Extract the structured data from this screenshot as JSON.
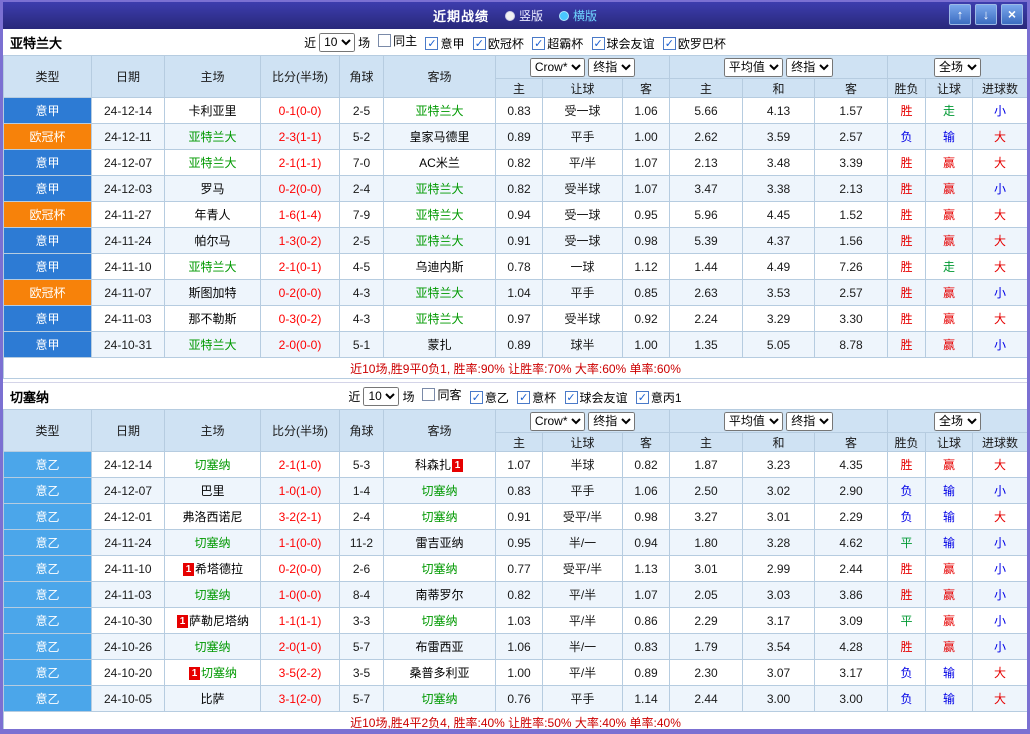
{
  "titlebar": {
    "title": "近期战绩",
    "vertical_label": "竖版",
    "horizontal_label": "横版",
    "up_icon": "↑",
    "down_icon": "↓",
    "close_icon": "×"
  },
  "filter_labels": {
    "near": "近",
    "count": "10",
    "games": "场"
  },
  "table_head": {
    "type": "类型",
    "date": "日期",
    "home": "主场",
    "score": "比分(半场)",
    "corner": "角球",
    "away": "客场",
    "odds_home": "主",
    "odds_handicap": "让球",
    "odds_away": "客",
    "avg_home": "主",
    "avg_draw": "和",
    "avg_away": "客",
    "result": "胜负",
    "handicap_result": "让球",
    "goals": "进球数",
    "odds_select": "Crow*",
    "final_select": "终指",
    "avg_select": "平均值",
    "avg_final_select": "终指",
    "scope_select": "全场"
  },
  "colors": {
    "accent_purple": "#7b70d2",
    "titlebar_blue": "#32329b",
    "league_seriea_blue": "#2d7bd4",
    "league_ucl_orange": "#f7820a",
    "league_serieb_blue": "#4ba6ea",
    "win_red": "#e60000",
    "lose_blue": "#0000e6",
    "draw_green": "#009933",
    "team_green": "#009900",
    "score_red": "#ff0000",
    "header_bg": "#cfe2f3"
  },
  "sections": [
    {
      "team": "亚特兰大",
      "checkboxes": [
        {
          "label": "同主",
          "checked": false
        },
        {
          "label": "意甲",
          "checked": true
        },
        {
          "label": "欧冠杯",
          "checked": true
        },
        {
          "label": "超霸杯",
          "checked": true
        },
        {
          "label": "球会友谊",
          "checked": true
        },
        {
          "label": "欧罗巴杯",
          "checked": true
        }
      ],
      "rows": [
        {
          "league": "意甲",
          "date": "24-12-14",
          "home": "卡利亚里",
          "score": "0-1(0-0)",
          "corner": "2-5",
          "away": "亚特兰大",
          "o1": "0.83",
          "o2": "受一球",
          "o3": "1.06",
          "a1": "5.66",
          "a2": "4.13",
          "a3": "1.57",
          "r1": "胜",
          "r2": "走",
          "r3": "小"
        },
        {
          "league": "欧冠杯",
          "date": "24-12-11",
          "home": "亚特兰大",
          "score": "2-3(1-1)",
          "corner": "5-2",
          "away": "皇家马德里",
          "o1": "0.89",
          "o2": "平手",
          "o3": "1.00",
          "a1": "2.62",
          "a2": "3.59",
          "a3": "2.57",
          "r1": "负",
          "r2": "输",
          "r3": "大"
        },
        {
          "league": "意甲",
          "date": "24-12-07",
          "home": "亚特兰大",
          "score": "2-1(1-1)",
          "corner": "7-0",
          "away": "AC米兰",
          "o1": "0.82",
          "o2": "平/半",
          "o3": "1.07",
          "a1": "2.13",
          "a2": "3.48",
          "a3": "3.39",
          "r1": "胜",
          "r2": "赢",
          "r3": "大"
        },
        {
          "league": "意甲",
          "date": "24-12-03",
          "home": "罗马",
          "score": "0-2(0-0)",
          "corner": "2-4",
          "away": "亚特兰大",
          "o1": "0.82",
          "o2": "受半球",
          "o3": "1.07",
          "a1": "3.47",
          "a2": "3.38",
          "a3": "2.13",
          "r1": "胜",
          "r2": "赢",
          "r3": "小"
        },
        {
          "league": "欧冠杯",
          "date": "24-11-27",
          "home": "年青人",
          "score": "1-6(1-4)",
          "corner": "7-9",
          "away": "亚特兰大",
          "o1": "0.94",
          "o2": "受一球",
          "o3": "0.95",
          "a1": "5.96",
          "a2": "4.45",
          "a3": "1.52",
          "r1": "胜",
          "r2": "赢",
          "r3": "大"
        },
        {
          "league": "意甲",
          "date": "24-11-24",
          "home": "帕尔马",
          "score": "1-3(0-2)",
          "corner": "2-5",
          "away": "亚特兰大",
          "o1": "0.91",
          "o2": "受一球",
          "o3": "0.98",
          "a1": "5.39",
          "a2": "4.37",
          "a3": "1.56",
          "r1": "胜",
          "r2": "赢",
          "r3": "大"
        },
        {
          "league": "意甲",
          "date": "24-11-10",
          "home": "亚特兰大",
          "score": "2-1(0-1)",
          "corner": "4-5",
          "away": "乌迪内斯",
          "o1": "0.78",
          "o2": "一球",
          "o3": "1.12",
          "a1": "1.44",
          "a2": "4.49",
          "a3": "7.26",
          "r1": "胜",
          "r2": "走",
          "r3": "大"
        },
        {
          "league": "欧冠杯",
          "date": "24-11-07",
          "home": "斯图加特",
          "score": "0-2(0-0)",
          "corner": "4-3",
          "away": "亚特兰大",
          "o1": "1.04",
          "o2": "平手",
          "o3": "0.85",
          "a1": "2.63",
          "a2": "3.53",
          "a3": "2.57",
          "r1": "胜",
          "r2": "赢",
          "r3": "小"
        },
        {
          "league": "意甲",
          "date": "24-11-03",
          "home": "那不勒斯",
          "score": "0-3(0-2)",
          "corner": "4-3",
          "away": "亚特兰大",
          "o1": "0.97",
          "o2": "受半球",
          "o3": "0.92",
          "a1": "2.24",
          "a2": "3.29",
          "a3": "3.30",
          "r1": "胜",
          "r2": "赢",
          "r3": "大"
        },
        {
          "league": "意甲",
          "date": "24-10-31",
          "home": "亚特兰大",
          "score": "2-0(0-0)",
          "corner": "5-1",
          "away": "蒙扎",
          "o1": "0.89",
          "o2": "球半",
          "o3": "1.00",
          "a1": "1.35",
          "a2": "5.05",
          "a3": "8.78",
          "r1": "胜",
          "r2": "赢",
          "r3": "小"
        }
      ],
      "summary": "近10场,胜9平0负1, 胜率:90% 让胜率:70% 大率:60% 单率:60%"
    },
    {
      "team": "切塞纳",
      "checkboxes": [
        {
          "label": "同客",
          "checked": false
        },
        {
          "label": "意乙",
          "checked": true
        },
        {
          "label": "意杯",
          "checked": true
        },
        {
          "label": "球会友谊",
          "checked": true
        },
        {
          "label": "意丙1",
          "checked": true
        }
      ],
      "rows": [
        {
          "league": "意乙",
          "date": "24-12-14",
          "home": "切塞纳",
          "score": "2-1(1-0)",
          "corner": "5-3",
          "away": "科森扎",
          "away_card": "1",
          "away_card_pos": "right",
          "o1": "1.07",
          "o2": "半球",
          "o3": "0.82",
          "a1": "1.87",
          "a2": "3.23",
          "a3": "4.35",
          "r1": "胜",
          "r2": "赢",
          "r3": "大"
        },
        {
          "league": "意乙",
          "date": "24-12-07",
          "home": "巴里",
          "score": "1-0(1-0)",
          "corner": "1-4",
          "away": "切塞纳",
          "o1": "0.83",
          "o2": "平手",
          "o3": "1.06",
          "a1": "2.50",
          "a2": "3.02",
          "a3": "2.90",
          "r1": "负",
          "r2": "输",
          "r3": "小"
        },
        {
          "league": "意乙",
          "date": "24-12-01",
          "home": "弗洛西诺尼",
          "score": "3-2(2-1)",
          "corner": "2-4",
          "away": "切塞纳",
          "o1": "0.91",
          "o2": "受平/半",
          "o3": "0.98",
          "a1": "3.27",
          "a2": "3.01",
          "a3": "2.29",
          "r1": "负",
          "r2": "输",
          "r3": "大"
        },
        {
          "league": "意乙",
          "date": "24-11-24",
          "home": "切塞纳",
          "score": "1-1(0-0)",
          "corner": "11-2",
          "away": "雷吉亚纳",
          "o1": "0.95",
          "o2": "半/一",
          "o3": "0.94",
          "a1": "1.80",
          "a2": "3.28",
          "a3": "4.62",
          "r1": "平",
          "r2": "输",
          "r3": "小"
        },
        {
          "league": "意乙",
          "date": "24-11-10",
          "home": "希塔德拉",
          "home_card": "1",
          "home_card_pos": "left",
          "score": "0-2(0-0)",
          "corner": "2-6",
          "away": "切塞纳",
          "o1": "0.77",
          "o2": "受平/半",
          "o3": "1.13",
          "a1": "3.01",
          "a2": "2.99",
          "a3": "2.44",
          "r1": "胜",
          "r2": "赢",
          "r3": "小"
        },
        {
          "league": "意乙",
          "date": "24-11-03",
          "home": "切塞纳",
          "score": "1-0(0-0)",
          "corner": "8-4",
          "away": "南蒂罗尔",
          "o1": "0.82",
          "o2": "平/半",
          "o3": "1.07",
          "a1": "2.05",
          "a2": "3.03",
          "a3": "3.86",
          "r1": "胜",
          "r2": "赢",
          "r3": "小"
        },
        {
          "league": "意乙",
          "date": "24-10-30",
          "home": "萨勒尼塔纳",
          "home_card": "1",
          "home_card_pos": "left",
          "score": "1-1(1-1)",
          "corner": "3-3",
          "away": "切塞纳",
          "o1": "1.03",
          "o2": "平/半",
          "o3": "0.86",
          "a1": "2.29",
          "a2": "3.17",
          "a3": "3.09",
          "r1": "平",
          "r2": "赢",
          "r3": "小"
        },
        {
          "league": "意乙",
          "date": "24-10-26",
          "home": "切塞纳",
          "score": "2-0(1-0)",
          "corner": "5-7",
          "away": "布雷西亚",
          "o1": "1.06",
          "o2": "半/一",
          "o3": "0.83",
          "a1": "1.79",
          "a2": "3.54",
          "a3": "4.28",
          "r1": "胜",
          "r2": "赢",
          "r3": "小"
        },
        {
          "league": "意乙",
          "date": "24-10-20",
          "home": "切塞纳",
          "home_card": "1",
          "home_card_pos": "left",
          "score": "3-5(2-2)",
          "corner": "3-5",
          "away": "桑普多利亚",
          "o1": "1.00",
          "o2": "平/半",
          "o3": "0.89",
          "a1": "2.30",
          "a2": "3.07",
          "a3": "3.17",
          "r1": "负",
          "r2": "输",
          "r3": "大"
        },
        {
          "league": "意乙",
          "date": "24-10-05",
          "home": "比萨",
          "score": "3-1(2-0)",
          "corner": "5-7",
          "away": "切塞纳",
          "o1": "0.76",
          "o2": "平手",
          "o3": "1.14",
          "a1": "2.44",
          "a2": "3.00",
          "a3": "3.00",
          "r1": "负",
          "r2": "输",
          "r3": "大"
        }
      ],
      "summary": "近10场,胜4平2负4, 胜率:40% 让胜率:50% 大率:40% 单率:40%"
    }
  ]
}
